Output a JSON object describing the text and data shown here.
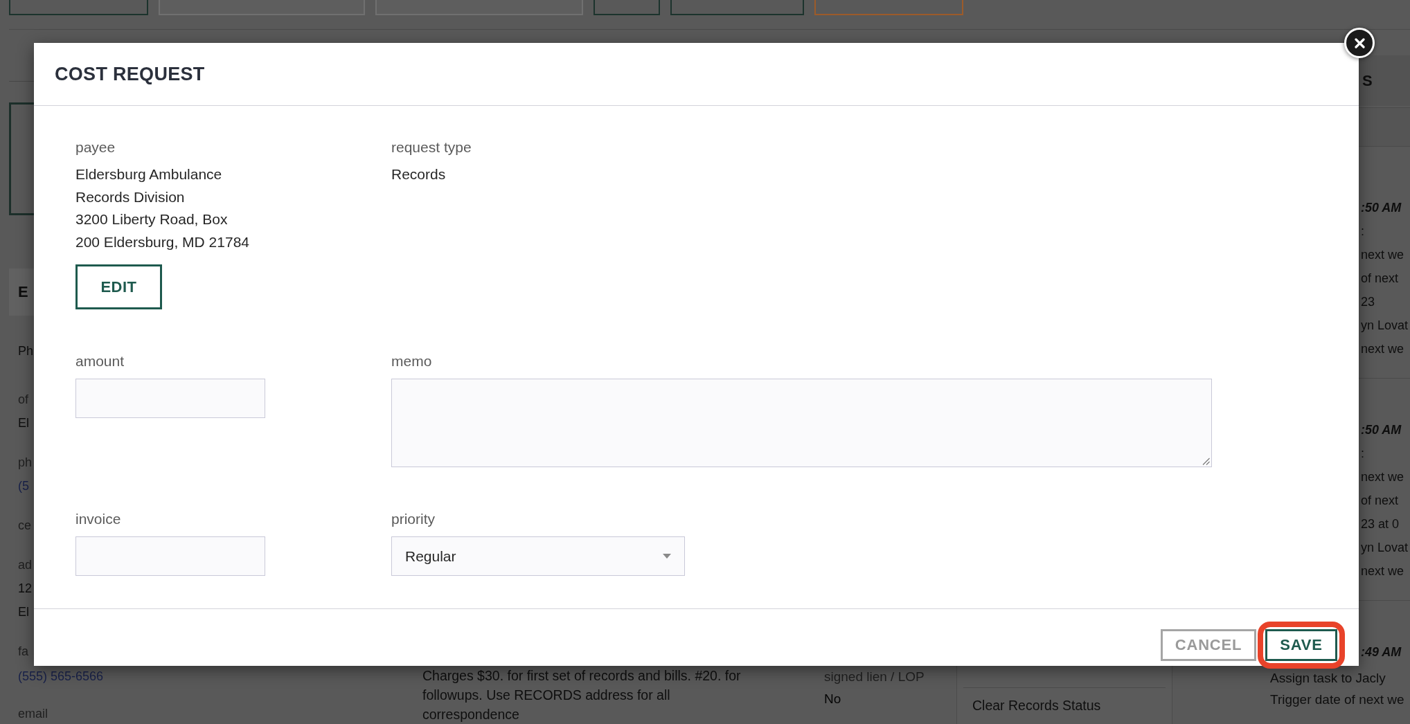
{
  "toolbar": [
    {
      "kind": "primary"
    },
    {
      "kind": "secondary"
    },
    {
      "kind": "secondary"
    },
    {
      "kind": "primary"
    },
    {
      "kind": "primary"
    },
    {
      "kind": "warning"
    }
  ],
  "left_panel": {
    "title": "E",
    "rows": [
      {
        "kind": "text",
        "text": "Ph"
      },
      {
        "kind": "label",
        "text": "of"
      },
      {
        "kind": "value",
        "text": "El"
      },
      {
        "kind": "label",
        "text": "ph"
      },
      {
        "kind": "link",
        "text": "(5"
      },
      {
        "kind": "label",
        "text": "ce"
      },
      {
        "kind": "label",
        "text": "ad"
      },
      {
        "kind": "value",
        "text": "12"
      },
      {
        "kind": "value",
        "text": "El"
      },
      {
        "kind": "label",
        "text": "fa"
      }
    ]
  },
  "modal": {
    "title": "COST REQUEST",
    "payee": {
      "label": "payee",
      "lines": [
        "Eldersburg Ambulance",
        "Records Division",
        "3200 Liberty Road, Box",
        "200 Eldersburg, MD 21784"
      ],
      "button": "EDIT"
    },
    "request_type": {
      "label": "request type",
      "value": "Records"
    },
    "amount": {
      "label": "amount"
    },
    "memo": {
      "label": "memo"
    },
    "invoice": {
      "label": "invoice"
    },
    "priority": {
      "label": "priority",
      "value": "Regular"
    },
    "buttons": [
      {
        "label": "CANCEL",
        "kind": "secondary",
        "highlighted": false
      },
      {
        "label": "SAVE",
        "kind": "primary",
        "highlighted": true
      }
    ]
  },
  "activity_panel": {
    "title": "S",
    "entries": [
      {
        "time": ":50 AM",
        "lines": [
          ":",
          "next we",
          "of next",
          "23",
          "yn Lovat",
          "next we"
        ]
      },
      {
        "time": ":50 AM",
        "lines": [
          ":",
          "next we",
          "of next",
          "23 at 0",
          "yn Lovat",
          "next we"
        ]
      },
      {
        "time": ":49 AM"
      }
    ]
  },
  "below_modal": {
    "contact_rows": [
      {
        "kind": "link",
        "text": "(555) 565-6566"
      },
      {
        "kind": "label",
        "text": "email"
      }
    ],
    "note_lines": [
      "Charges $30. for first set of records and bills. #20. for",
      "followups. Use RECORDS address for all",
      "correspondence"
    ],
    "lien": {
      "label": "signed lien / LOP",
      "value": "No"
    },
    "menu_items": [
      "Clear Records Status"
    ],
    "activity_lines": [
      "Assign task to Jacly",
      "Trigger date of next we"
    ]
  }
}
